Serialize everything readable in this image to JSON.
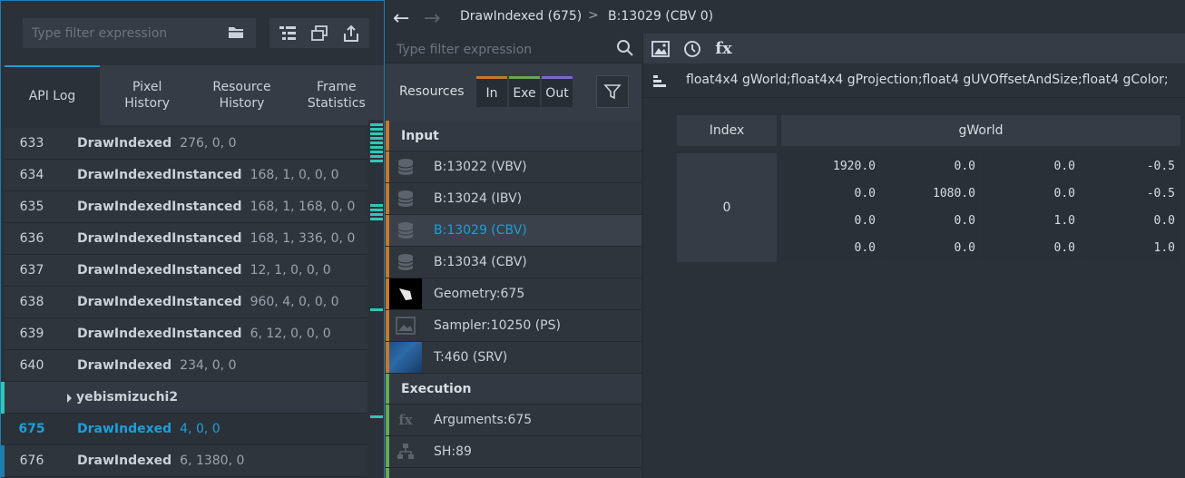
{
  "left": {
    "filter_placeholder": "Type filter expression",
    "tabs": [
      {
        "label": "API Log"
      },
      {
        "label": "Pixel\nHistory"
      },
      {
        "label": "Resource\nHistory"
      },
      {
        "label": "Frame\nStatistics"
      }
    ],
    "rows": [
      {
        "num": "633",
        "fn": "DrawIndexed",
        "args": "276, 0, 0"
      },
      {
        "num": "634",
        "fn": "DrawIndexedInstanced",
        "args": "168, 1, 0, 0, 0"
      },
      {
        "num": "635",
        "fn": "DrawIndexedInstanced",
        "args": "168, 1, 168, 0, 0"
      },
      {
        "num": "636",
        "fn": "DrawIndexedInstanced",
        "args": "168, 1, 336, 0, 0"
      },
      {
        "num": "637",
        "fn": "DrawIndexedInstanced",
        "args": "12, 1, 0, 0, 0"
      },
      {
        "num": "638",
        "fn": "DrawIndexedInstanced",
        "args": "960, 4, 0, 0, 0"
      },
      {
        "num": "639",
        "fn": "DrawIndexedInstanced",
        "args": "6, 12, 0, 0, 0"
      },
      {
        "num": "640",
        "fn": "DrawIndexed",
        "args": "234, 0, 0"
      }
    ],
    "group_row": {
      "label": "yebismizuchi2"
    },
    "selected_row": {
      "num": "675",
      "fn": "DrawIndexed",
      "args": "4, 0, 0"
    },
    "last_row": {
      "num": "676",
      "fn": "DrawIndexed",
      "args": "6, 1380, 0"
    }
  },
  "nav": {
    "crumb1": "DrawIndexed (675)",
    "separator": ">",
    "crumb2": "B:13029 (CBV 0)"
  },
  "mid": {
    "filter_placeholder": "Type filter expression",
    "resources_label": "Resources",
    "toggles": [
      {
        "label": "In",
        "color": "#c9782a"
      },
      {
        "label": "Exe",
        "color": "#6aa84f"
      },
      {
        "label": "Out",
        "color": "#7b68c9"
      }
    ],
    "input_section": "Input",
    "input_items": [
      {
        "label": "B:13022 (VBV)",
        "icon": "database-icon"
      },
      {
        "label": "B:13024 (IBV)",
        "icon": "database-icon"
      },
      {
        "label": "B:13029 (CBV)",
        "icon": "database-icon"
      },
      {
        "label": "B:13034 (CBV)",
        "icon": "database-icon"
      },
      {
        "label": "Geometry:675",
        "icon": "geometry-thumbnail"
      },
      {
        "label": "Sampler:10250 (PS)",
        "icon": "image-icon"
      },
      {
        "label": "T:460 (SRV)",
        "icon": "texture-thumbnail"
      }
    ],
    "execution_section": "Execution",
    "execution_items": [
      {
        "label": "Arguments:675",
        "icon": "fx-icon"
      },
      {
        "label": "SH:89",
        "icon": "shader-tree-icon"
      }
    ]
  },
  "right": {
    "tools": [
      "image-icon",
      "clock-icon",
      "fx-icon"
    ],
    "fx_label": "fx",
    "struct": "float4x4 gWorld;float4x4 gProjection;float4 gUVOffsetAndSize;float4 gColor;",
    "table": {
      "headers": [
        "Index",
        "gWorld"
      ],
      "index": "0",
      "matrix": [
        [
          "1920.0",
          "0.0",
          "0.0",
          "-0.5"
        ],
        [
          "0.0",
          "1080.0",
          "0.0",
          "-0.5"
        ],
        [
          "0.0",
          "0.0",
          "1.0",
          "0.0"
        ],
        [
          "0.0",
          "0.0",
          "0.0",
          "1.0"
        ]
      ]
    }
  }
}
